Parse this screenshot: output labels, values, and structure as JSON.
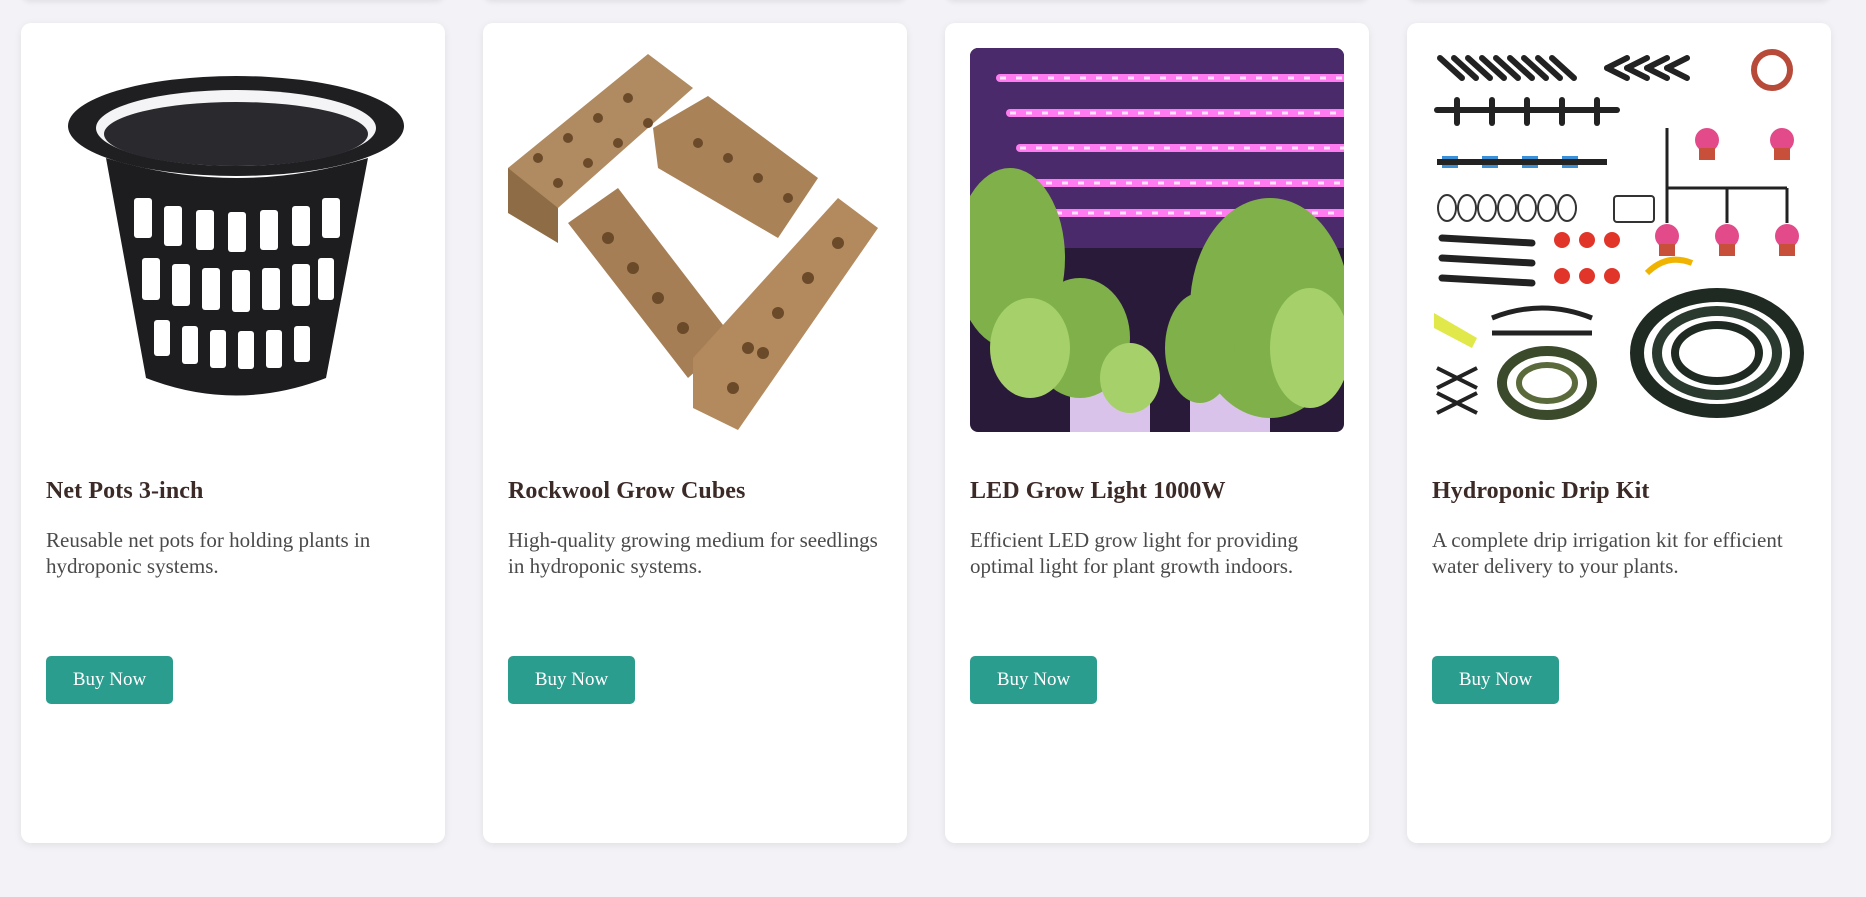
{
  "products": [
    {
      "title": "Net Pots 3-inch",
      "description": "Reusable net pots for holding plants in hydroponic systems.",
      "button_label": "Buy Now",
      "image": "net-pot-image"
    },
    {
      "title": "Rockwool Grow Cubes",
      "description": "High-quality growing medium for seedlings in hydroponic systems.",
      "button_label": "Buy Now",
      "image": "rockwool-cubes-image"
    },
    {
      "title": "LED Grow Light 1000W",
      "description": "Efficient LED grow light for providing optimal light for plant growth indoors.",
      "button_label": "Buy Now",
      "image": "led-grow-light-image"
    },
    {
      "title": "Hydroponic Drip Kit",
      "description": "A complete drip irrigation kit for efficient water delivery to your plants.",
      "button_label": "Buy Now",
      "image": "drip-kit-image"
    }
  ],
  "colors": {
    "background": "#f3f3f7",
    "card": "#ffffff",
    "button": "#2a9d8f",
    "title": "#3b2a26",
    "description": "#4a4a4a"
  }
}
